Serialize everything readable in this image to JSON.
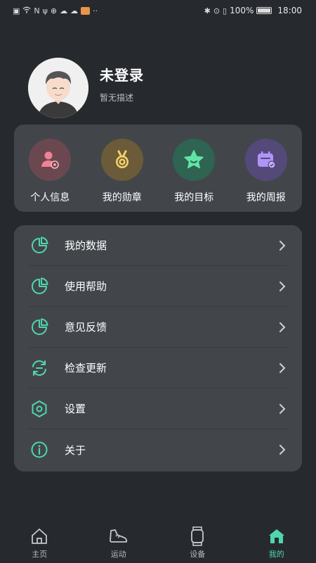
{
  "status_bar": {
    "battery": "100%",
    "time": "18:00"
  },
  "profile": {
    "name": "未登录",
    "description": "暂无描述"
  },
  "shortcuts": [
    {
      "label": "个人信息",
      "icon": "person-card-icon",
      "color": "#e8607a"
    },
    {
      "label": "我的勋章",
      "icon": "medal-icon",
      "color": "#e8c45a"
    },
    {
      "label": "我的目标",
      "icon": "star-icon",
      "color": "#5fe0a0"
    },
    {
      "label": "我的周报",
      "icon": "calendar-check-icon",
      "color": "#a78bfa"
    }
  ],
  "menu": [
    {
      "label": "我的数据",
      "icon": "pie-chart-icon"
    },
    {
      "label": "使用帮助",
      "icon": "pie-chart-icon"
    },
    {
      "label": "意见反馈",
      "icon": "pie-chart-icon"
    },
    {
      "label": "检查更新",
      "icon": "refresh-icon"
    },
    {
      "label": "设置",
      "icon": "hexagon-settings-icon"
    },
    {
      "label": "关于",
      "icon": "info-icon"
    }
  ],
  "tabs": [
    {
      "label": "主页",
      "icon": "home-icon",
      "active": false
    },
    {
      "label": "运动",
      "icon": "shoe-icon",
      "active": false
    },
    {
      "label": "设备",
      "icon": "watch-icon",
      "active": false
    },
    {
      "label": "我的",
      "icon": "home-filled-icon",
      "active": true
    }
  ],
  "colors": {
    "accent": "#4fd6b0",
    "background": "#262a2e",
    "card": "#42464b"
  }
}
